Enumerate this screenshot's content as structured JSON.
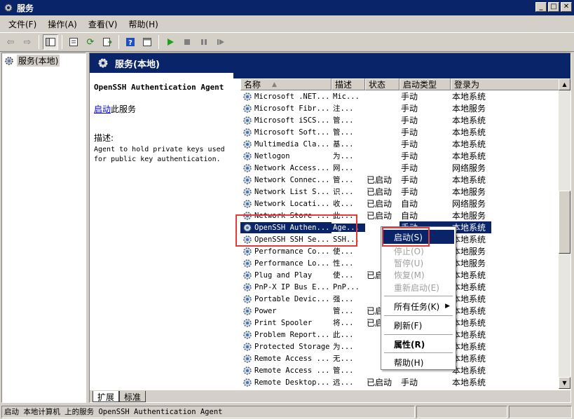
{
  "window": {
    "title": "服务"
  },
  "menubar": {
    "items": [
      "文件(F)",
      "操作(A)",
      "查看(V)",
      "帮助(H)"
    ]
  },
  "tree": {
    "root_label": "服务(本地)"
  },
  "panel": {
    "header_title": "服务(本地)",
    "service_name": "OpenSSH Authentication Agent",
    "start_link": "启动",
    "start_suffix": "此服务",
    "desc_label": "描述:",
    "desc_text": "Agent to hold private keys used for public key authentication."
  },
  "columns": [
    "名称",
    "描述",
    "状态",
    "启动类型",
    "登录为"
  ],
  "rows": [
    {
      "name": "Microsoft .NET...",
      "desc": "Mic...",
      "status": "",
      "startup": "手动",
      "logon": "本地系统"
    },
    {
      "name": "Microsoft Fibr...",
      "desc": "注...",
      "status": "",
      "startup": "手动",
      "logon": "本地服务"
    },
    {
      "name": "Microsoft iSCS...",
      "desc": "管...",
      "status": "",
      "startup": "手动",
      "logon": "本地系统"
    },
    {
      "name": "Microsoft Soft...",
      "desc": "管...",
      "status": "",
      "startup": "手动",
      "logon": "本地系统"
    },
    {
      "name": "Multimedia Cla...",
      "desc": "基...",
      "status": "",
      "startup": "手动",
      "logon": "本地系统"
    },
    {
      "name": "Netlogon",
      "desc": "为...",
      "status": "",
      "startup": "手动",
      "logon": "本地系统"
    },
    {
      "name": "Network Access...",
      "desc": "网...",
      "status": "",
      "startup": "手动",
      "logon": "网络服务"
    },
    {
      "name": "Network Connec...",
      "desc": "管...",
      "status": "已启动",
      "startup": "手动",
      "logon": "本地系统"
    },
    {
      "name": "Network List S...",
      "desc": "识...",
      "status": "已启动",
      "startup": "手动",
      "logon": "本地服务"
    },
    {
      "name": "Network Locati...",
      "desc": "收...",
      "status": "已启动",
      "startup": "自动",
      "logon": "网络服务"
    },
    {
      "name": "Network Store ...",
      "desc": "此...",
      "status": "已启动",
      "startup": "自动",
      "logon": "本地服务"
    },
    {
      "name": "OpenSSH Authen...",
      "desc": "Age...",
      "status": "",
      "startup": "手动",
      "logon": "本地系统"
    },
    {
      "name": "OpenSSH SSH Se...",
      "desc": "SSH...",
      "status": "",
      "startup": "",
      "logon": "本地系统"
    },
    {
      "name": "Performance Co...",
      "desc": "使...",
      "status": "",
      "startup": "",
      "logon": "本地服务"
    },
    {
      "name": "Performance Lo...",
      "desc": "性...",
      "status": "",
      "startup": "",
      "logon": "本地服务"
    },
    {
      "name": "Plug and Play",
      "desc": "使...",
      "status": "已启",
      "startup": "",
      "logon": "本地系统"
    },
    {
      "name": "PnP-X IP Bus E...",
      "desc": "PnP...",
      "status": "",
      "startup": "",
      "logon": "本地系统"
    },
    {
      "name": "Portable Devic...",
      "desc": "强...",
      "status": "",
      "startup": "",
      "logon": "本地系统"
    },
    {
      "name": "Power",
      "desc": "管...",
      "status": "已启",
      "startup": "",
      "logon": "本地系统"
    },
    {
      "name": "Print Spooler",
      "desc": "将...",
      "status": "已启",
      "startup": "",
      "logon": "本地系统"
    },
    {
      "name": "Problem Report...",
      "desc": "此...",
      "status": "",
      "startup": "",
      "logon": "本地系统"
    },
    {
      "name": "Protected Storage",
      "desc": "为...",
      "status": "",
      "startup": "",
      "logon": "本地系统"
    },
    {
      "name": "Remote Access ...",
      "desc": "无...",
      "status": "",
      "startup": "",
      "logon": "本地系统"
    },
    {
      "name": "Remote Access ...",
      "desc": "管...",
      "status": "",
      "startup": "",
      "logon": "本地系统"
    },
    {
      "name": "Remote Desktop...",
      "desc": "远...",
      "status": "已启动",
      "startup": "手动",
      "logon": "本地系统"
    }
  ],
  "selected_row": 11,
  "context_menu": {
    "start": "启动(S)",
    "stop": "停止(O)",
    "pause": "暂停(U)",
    "resume": "恢复(M)",
    "restart": "重新启动(E)",
    "all_tasks": "所有任务(K)",
    "refresh": "刷新(F)",
    "properties": "属性(R)",
    "help": "帮助(H)"
  },
  "tabs": [
    "扩展",
    "标准"
  ],
  "statusbar": {
    "text": "启动 本地计算机 上的服务 OpenSSH Authentication Agent"
  },
  "colors": {
    "title_bg": "#0a246a",
    "highlight_box": "#e53a3a",
    "chrome": "#d4d0c8"
  }
}
